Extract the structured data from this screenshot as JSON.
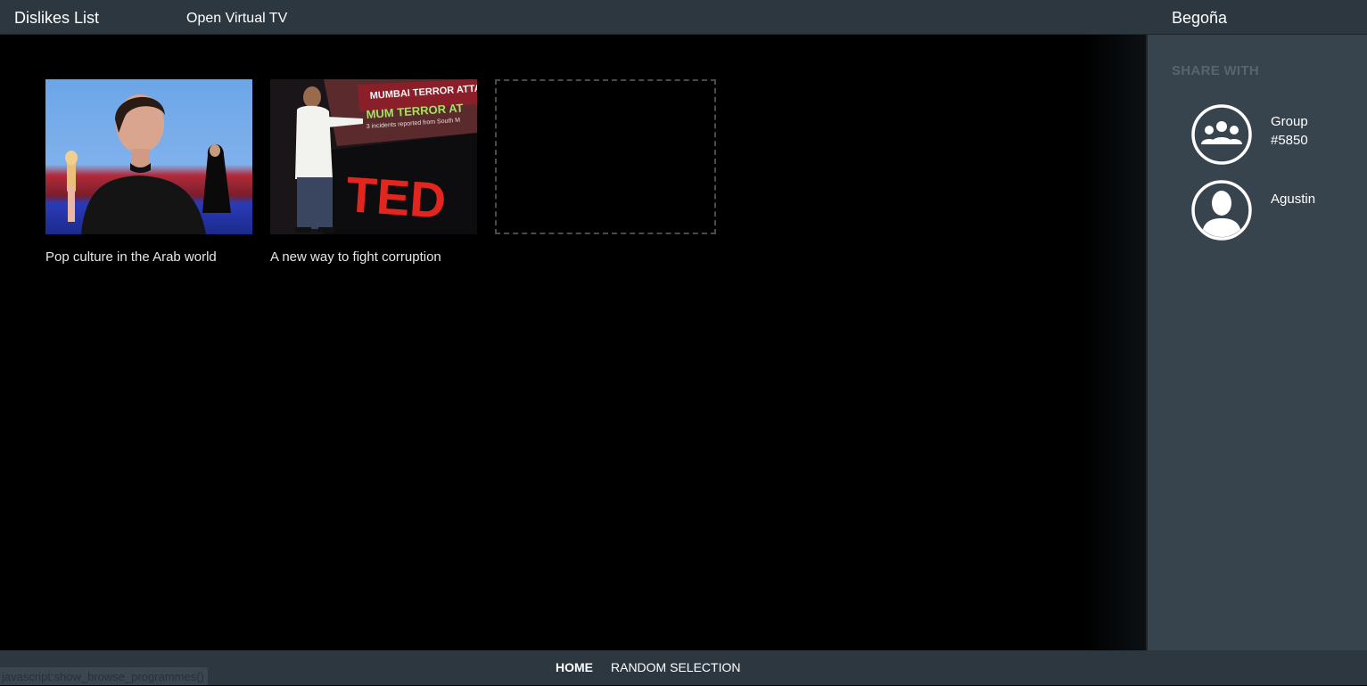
{
  "header": {
    "page_title": "Dislikes List",
    "app_name": "Open Virtual TV",
    "user_name": "Begoña"
  },
  "programmes": [
    {
      "title": "Pop culture in the Arab world",
      "thumb_icon": "woman-with-dolls-thumbnail"
    },
    {
      "title": "A new way to fight corruption",
      "thumb_icon": "ted-speaker-thumbnail",
      "thumb_text": [
        "MUMBAI TERROR ATTA",
        "MUM TERROR AT",
        "3 incidents reported from South M",
        "TED"
      ]
    }
  ],
  "sidebar": {
    "title": "SHARE WITH",
    "contacts": [
      {
        "name": "Group\n#5850",
        "icon": "group-avatar-icon"
      },
      {
        "name": "Agustin",
        "icon": "user-avatar-icon"
      }
    ]
  },
  "footer": {
    "home_label": "HOME",
    "random_label": "RANDOM SELECTION"
  },
  "status_text": "javascript:show_browse_programmes()",
  "colors": {
    "topbar": "#2c3740",
    "sidebar": "#37444d",
    "background": "#000000"
  }
}
